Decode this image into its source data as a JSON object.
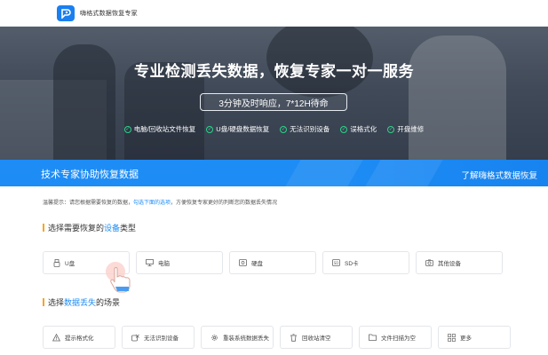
{
  "header": {
    "brand": "嗨格式数据恢复专家"
  },
  "hero": {
    "title": "专业检测丢失数据，恢复专家一对一服务",
    "pill": "3分钟及时响应，7*12H待命",
    "features": [
      "电脑/回收站文件恢复",
      "U盘/硬盘数据恢复",
      "无法识别设备",
      "误格式化",
      "开盘维修"
    ]
  },
  "banner": {
    "left": "技术专家协助恢复数据",
    "right": "了解嗨格式数据恢复"
  },
  "hint": {
    "prefix": "温馨提示：请您根据需要恢复的数据，",
    "link": "勾选下面的选项",
    "suffix": "，方便恢复专家更好的判断您的数据丢失情况"
  },
  "device_section": {
    "title_a": "选择需要恢复的",
    "title_em": "设备",
    "title_b": "类型",
    "options": [
      {
        "label": "U盘",
        "icon": "usb-drive-icon"
      },
      {
        "label": "电脑",
        "icon": "monitor-icon"
      },
      {
        "label": "硬盘",
        "icon": "hard-disk-icon"
      },
      {
        "label": "SD卡",
        "icon": "sd-card-icon"
      },
      {
        "label": "其他设备",
        "icon": "camera-icon"
      }
    ]
  },
  "scene_section": {
    "title_a": "选择",
    "title_em": "数据丢失",
    "title_b": "的场景",
    "options": [
      {
        "label": "提示格式化",
        "icon": "warning-icon"
      },
      {
        "label": "无法识别设备",
        "icon": "unrecognized-device-icon"
      },
      {
        "label": "重装系统数据丢失",
        "icon": "gear-icon"
      },
      {
        "label": "回收站清空",
        "icon": "trash-icon"
      },
      {
        "label": "文件扫描为空",
        "icon": "folder-icon"
      },
      {
        "label": "更多",
        "icon": "more-icon"
      }
    ]
  },
  "colors": {
    "accent": "#1e8cf5",
    "marker": "#f5a623",
    "check": "#2fd08a"
  }
}
